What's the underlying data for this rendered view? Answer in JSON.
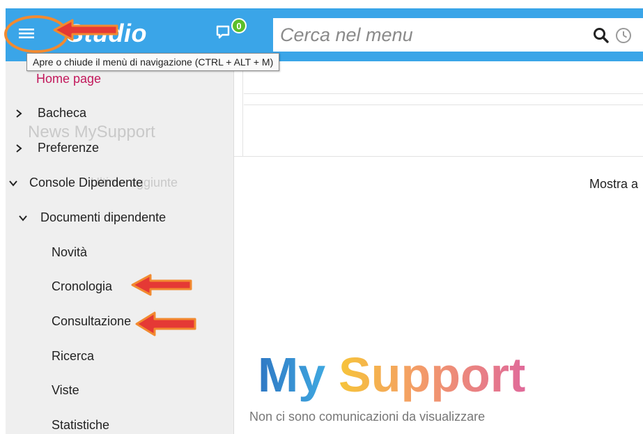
{
  "header": {
    "brand_text": "Studio",
    "notification_count": "0",
    "search_placeholder": "Cerca nel menu",
    "icons": [
      "menu-icon",
      "notification-icon",
      "search-icon",
      "clock-icon"
    ],
    "accent_color": "#3aa5e8",
    "badge_color": "#5cbf2a"
  },
  "tooltip": {
    "text": "Apre o chiude il menù di navigazione (CTRL + ALT + M)"
  },
  "sidebar": {
    "home": "Home page",
    "items": [
      {
        "label": "Bacheca",
        "state": "collapsed"
      },
      {
        "label": "Preferenze",
        "state": "collapsed"
      },
      {
        "label": "Console Dipendente",
        "state": "expanded"
      }
    ],
    "group": {
      "label": "Documenti dipendente",
      "state": "expanded"
    },
    "subitems": [
      "Novità",
      "Cronologia",
      "Consultazione",
      "Ricerca",
      "Viste",
      "Statistiche"
    ],
    "ghost_texts": [
      "News MySupport",
      "Ultime aggiunte"
    ]
  },
  "main": {
    "show_label": "Mostra a",
    "logo_text_a": "My",
    "logo_text_b": "Support",
    "empty_message": "Non ci sono comunicazioni da visualizzare"
  },
  "annotations": {
    "arrow_color": "#e53935",
    "outline_color": "#f28a30"
  }
}
